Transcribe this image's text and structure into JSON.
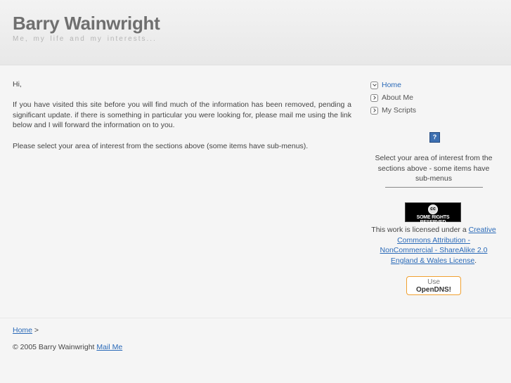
{
  "header": {
    "title": "Barry Wainwright",
    "tagline": "Me, my life and my interests..."
  },
  "main": {
    "greeting": "Hi,",
    "para1": "If you have visited this site before you will find much of the information has been removed, pending a significant update. if there is something in particular you were looking for, please mail me using the link below and I will forward the information on to you.",
    "para2": "Please select your area of interest from the sections above (some items have sub-menus)."
  },
  "sidebar": {
    "nav": [
      {
        "label": "Home",
        "icon": "collapse-icon",
        "active": true
      },
      {
        "label": "About Me",
        "icon": "expand-icon",
        "active": false
      },
      {
        "label": "My Scripts",
        "icon": "expand-icon",
        "active": false
      }
    ],
    "help_icon": "?",
    "help_text": "Select your area of interest from the sections above - some items have sub-menus",
    "cc_badge": {
      "symbol": "cc",
      "text": "SOME RIGHTS RESERVED"
    },
    "license_prefix": "This work is licensed under a ",
    "license_link": "Creative Commons Attribution - NonCommercial - ShareAlike 2.0 England & Wales License",
    "license_suffix": ".",
    "opendns": {
      "use": "Use",
      "brand": "OpenDNS!"
    }
  },
  "footer": {
    "breadcrumb_link": "Home",
    "breadcrumb_sep": " >",
    "copyright": "© 2005 Barry Wainwright ",
    "mail_link": "Mail Me"
  },
  "colors": {
    "link": "#2a6ab8",
    "title": "#6f6f6f",
    "opendns_border": "#f0a030"
  }
}
